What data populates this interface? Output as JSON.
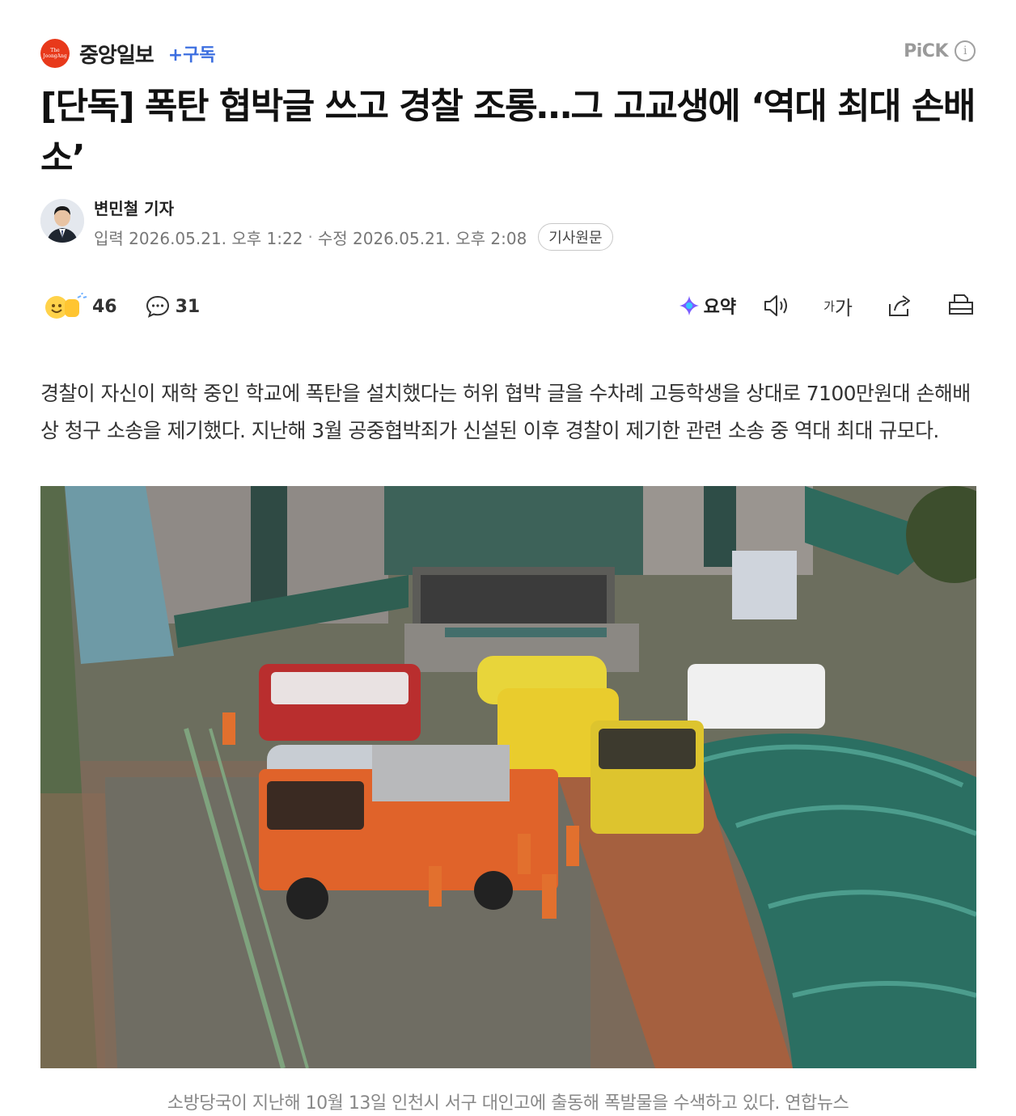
{
  "press": {
    "logo_text": "The JoongAng",
    "name": "중앙일보",
    "subscribe_label": "+구독",
    "pick_label": "PiCK",
    "info_icon": "info-icon"
  },
  "article": {
    "title": "[단독] 폭탄 협박글 쓰고 경찰 조롱…그 고교생에 ‘역대 최대 손배소’",
    "reporter": "변민철 기자",
    "input_label": "입력",
    "input_date": "2026.05.21. 오후 1:22",
    "modified_label": "수정",
    "modified_date": "2026.05.21. 오후 2:08",
    "original_button": "기사원문",
    "lead": "경찰이 자신이 재학 중인 학교에 폭탄을 설치했다는 허위 협박 글을 수차례 고등학생을 상대로 7100만원대 손해배상 청구 소송을 제기했다. 지난해 3월 공중협박죄가 신설된 이후 경찰이 제기한 관련 소송 중 역대 최대 규모다.",
    "caption": "소방당국이 지난해 10월 13일 인천시 서구 대인고에 출동해 폭발물을 수색하고 있다. 연합뉴스"
  },
  "toolbar": {
    "reaction_count": "46",
    "comment_count": "31",
    "summary_label": "요약",
    "font_small": "가",
    "font_large": "가"
  },
  "colors": {
    "brand": "#e8391b",
    "subscribe": "#3d6fe0",
    "muted": "#777777"
  }
}
